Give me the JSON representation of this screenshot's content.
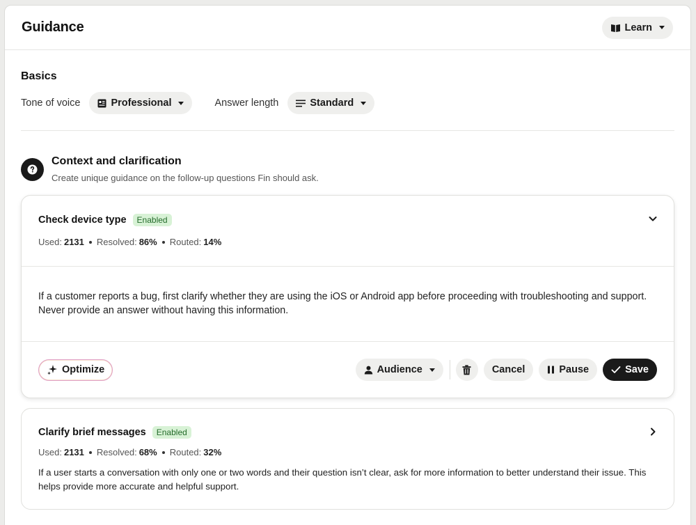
{
  "header": {
    "title": "Guidance",
    "learn_label": "Learn"
  },
  "basics": {
    "title": "Basics",
    "tone_label": "Tone of voice",
    "tone_value": "Professional",
    "length_label": "Answer length",
    "length_value": "Standard"
  },
  "context": {
    "title": "Context and clarification",
    "subtitle": "Create unique guidance on the follow-up questions Fin should ask."
  },
  "cards": [
    {
      "title": "Check device type",
      "badge": "Enabled",
      "used_label": "Used:",
      "used_value": "2131",
      "resolved_label": "Resolved:",
      "resolved_value": "86%",
      "routed_label": "Routed:",
      "routed_value": "14%",
      "body": "If a customer reports a bug, first clarify whether they are using the iOS or Android app before proceeding with troubleshooting and support. Never provide an answer without having this information.",
      "actions": {
        "optimize": "Optimize",
        "audience": "Audience",
        "cancel": "Cancel",
        "pause": "Pause",
        "save": "Save"
      }
    },
    {
      "title": "Clarify brief messages",
      "badge": "Enabled",
      "used_label": "Used:",
      "used_value": "2131",
      "resolved_label": "Resolved:",
      "resolved_value": "68%",
      "routed_label": "Routed:",
      "routed_value": "32%",
      "body": "If a user starts a conversation with only one or two words and their question isn’t clear, ask for more information to better understand their issue. This helps provide more accurate and helpful support."
    }
  ],
  "colors": {
    "badge_bg": "#d8f2d6",
    "badge_text": "#236b2a",
    "save_bg": "#1a1a1a"
  }
}
